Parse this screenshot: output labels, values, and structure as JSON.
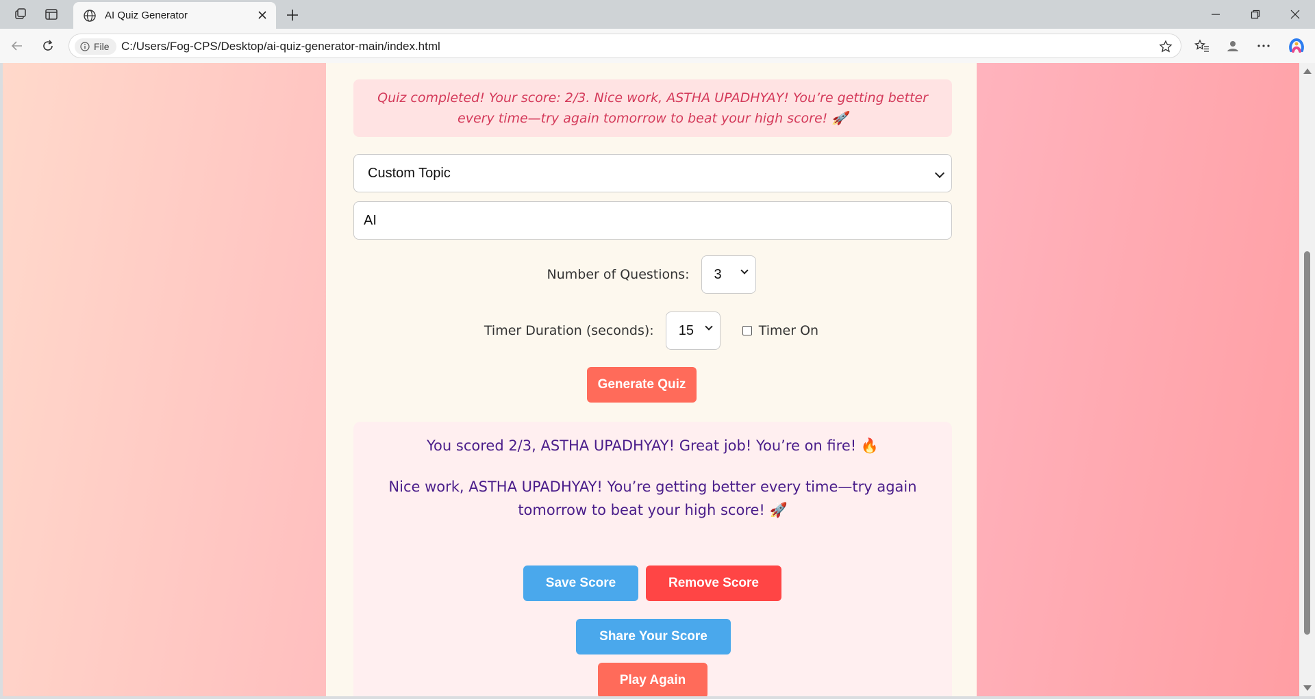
{
  "browser": {
    "tab_title": "AI Quiz Generator",
    "address_chip": "File",
    "url": "C:/Users/Fog-CPS/Desktop/ai-quiz-generator-main/index.html"
  },
  "page": {
    "alert_message": "Quiz completed! Your score: 2/3. Nice work, ASTHA UPADHYAY! You’re getting better every time—try again tomorrow to beat your high score! 🚀",
    "topic_select": {
      "selected": "Custom Topic"
    },
    "custom_topic_input": {
      "value": "AI"
    },
    "questions": {
      "label": "Number of Questions:",
      "selected": "3"
    },
    "timer": {
      "label": "Timer Duration (seconds):",
      "selected": "15",
      "toggle_label": "Timer On",
      "toggle_checked": false
    },
    "generate_button": "Generate Quiz",
    "results": {
      "score_line": "You scored 2/3, ASTHA UPADHYAY! Great job! You’re on fire! 🔥",
      "message_line": "Nice work, ASTHA UPADHYAY! You’re getting better every time—try again tomorrow to beat your high score! 🚀",
      "save_button": "Save Score",
      "remove_button": "Remove Score",
      "share_button": "Share Your Score",
      "play_again_button": "Play Again"
    }
  },
  "colors": {
    "coral": "#ff6b5a",
    "blue": "#4aa8ec",
    "red": "#ff4545",
    "result_text": "#4a1d8a",
    "alert_text": "#d43a5a"
  }
}
